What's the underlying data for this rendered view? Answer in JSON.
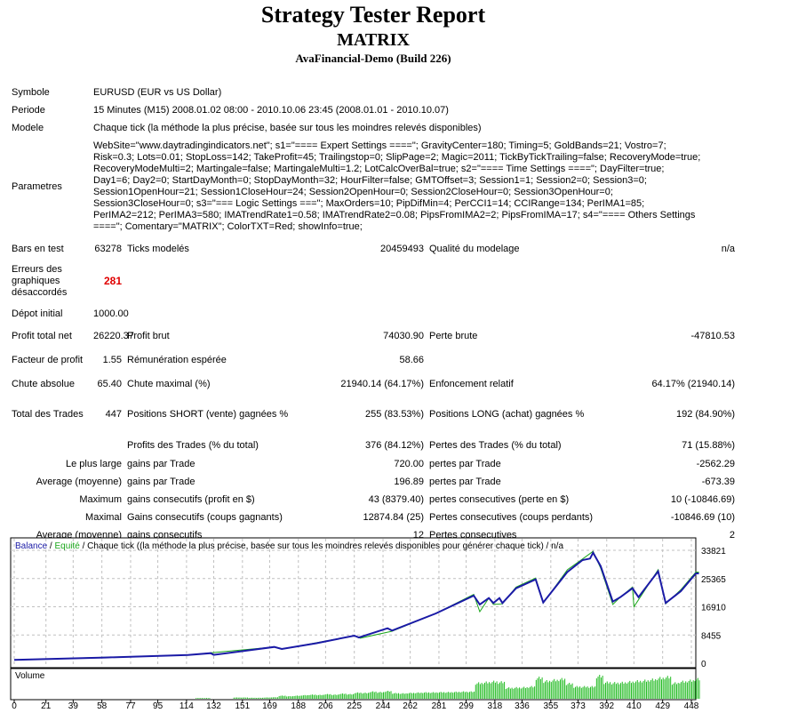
{
  "header": {
    "title": "Strategy Tester Report",
    "expert": "MATRIX",
    "server": "AvaFinancial-Demo (Build 226)"
  },
  "info": {
    "symbol_label": "Symbole",
    "symbol": "EURUSD (EUR vs US Dollar)",
    "period_label": "Periode",
    "period": "15 Minutes (M15) 2008.01.02 08:00 - 2010.10.06 23:45 (2008.01.01 - 2010.10.07)",
    "model_label": "Modele",
    "model": "Chaque tick (la méthode la plus précise, basée sur tous les moindres relevés disponibles)",
    "params_label": "Parametres",
    "params": "WebSite=\"www.daytradingindicators.net\"; s1=\"==== Expert Settings ====\"; GravityCenter=180; Timing=5; GoldBands=21; Vostro=7; Risk=0.3; Lots=0.01; StopLoss=142; TakeProfit=45; Trailingstop=0; SlipPage=2; Magic=2011; TickByTickTrailing=false; RecoveryMode=true; RecoveryModeMulti=2; Martingale=false; MartingaleMulti=1.2; LotCalcOverBal=true; s2=\"==== Time Settings ====\"; DayFilter=true; Day1=6; Day2=0; StartDayMonth=0; StopDayMonth=32; HourFilter=false; GMTOffset=3; Session1=1; Session2=0; Session3=0; Session1OpenHour=21; Session1CloseHour=24; Session2OpenHour=0; Session2CloseHour=0; Session3OpenHour=0; Session3CloseHour=0; s3=\"=== Logic Settings ===\"; MaxOrders=10; PipDifMin=4; PerCCI1=14; CCIRange=134; PerIMA1=85; PerIMA2=212; PerIMA3=580; IMATrendRate1=0.58; IMATrendRate2=0.08; PipsFromIMA2=2; PipsFromIMA=17; s4=\"==== Others Settings ====\"; Comentary=\"MATRIX\"; ColorTXT=Red; showInfo=true;"
  },
  "stats": {
    "bars_label": "Bars en test",
    "bars": "63278",
    "ticks_label": "Ticks modelés",
    "ticks": "20459493",
    "quality_label": "Qualité du modelage",
    "quality": "n/a",
    "errors_label": "Erreurs des graphiques désaccordés",
    "errors": "281",
    "deposit_label": "Dépot initial",
    "deposit": "1000.00",
    "net_label": "Profit total net",
    "net": "26220.37",
    "gross_profit_label": "Profit brut",
    "gross_profit": "74030.90",
    "gross_loss_label": "Perte brute",
    "gross_loss": "-47810.53",
    "pf_label": "Facteur de profit",
    "pf": "1.55",
    "payoff_label": "Rémunération espérée",
    "payoff": "58.66",
    "abs_dd_label": "Chute absolue",
    "abs_dd": "65.40",
    "max_dd_label": "Chute maximal (%)",
    "max_dd": "21940.14 (64.17%)",
    "rel_dd_label": "Enfoncement relatif",
    "rel_dd": "64.17% (21940.14)",
    "trades_label": "Total des Trades",
    "trades": "447",
    "short_label": "Positions SHORT (vente) gagnées %",
    "short": "255 (83.53%)",
    "long_label": "Positions LONG (achat) gagnées %",
    "long": "192 (84.90%)",
    "profit_trades_label": "Profits des Trades (% du total)",
    "profit_trades": "376 (84.12%)",
    "loss_trades_label": "Pertes des Trades (% du total)",
    "loss_trades": "71 (15.88%)",
    "largest_label": "Le plus large",
    "largest_win_label": "gains par Trade",
    "largest_win": "720.00",
    "largest_loss_label": "pertes par Trade",
    "largest_loss": "-2562.29",
    "avg_label": "Average (moyenne)",
    "avg_win_label": "gains par Trade",
    "avg_win": "196.89",
    "avg_loss_label": "pertes par Trade",
    "avg_loss": "-673.39",
    "maximum_label": "Maximum",
    "max_cons_win_label": "gains consecutifs (profit en $)",
    "max_cons_win": "43 (8379.40)",
    "max_cons_loss_label": "pertes consecutives (perte en $)",
    "max_cons_loss": "10 (-10846.69)",
    "maximal_label": "Maximal",
    "maximal_win_label": "Gains consecutifs (coups gagnants)",
    "maximal_win": "12874.84 (25)",
    "maximal_loss_label": "Pertes consecutives (coups perdants)",
    "maximal_loss": "-10846.69 (10)",
    "avg_cons_label": "Average (moyenne)",
    "avg_cons_win_label": "gains consecutifs",
    "avg_cons_win": "12",
    "avg_cons_loss_label": "Pertes consecutives",
    "avg_cons_loss": "2"
  },
  "chart_data": {
    "type": "line",
    "legend_balance": "Balance",
    "legend_sep1": " / ",
    "legend_equity": "Equité",
    "legend_rest": " / Chaque tick ((la méthode la plus précise, basée sur tous les moindres relevés disponibles pour générer chaque tick) / n/a",
    "volume_label": "Volume",
    "colors": {
      "balance": "#1a1aa6",
      "equity": "#1aa61a",
      "volume": "#22bb22",
      "grid": "#c0c0c0"
    },
    "xlim": [
      0,
      453
    ],
    "ylim": [
      0,
      33821
    ],
    "yticks": [
      "0",
      "8455",
      "16910",
      "25365",
      "33821"
    ],
    "xticks": [
      "0",
      "21",
      "39",
      "58",
      "77",
      "95",
      "114",
      "132",
      "151",
      "169",
      "188",
      "206",
      "225",
      "244",
      "262",
      "281",
      "299",
      "318",
      "336",
      "355",
      "373",
      "392",
      "410",
      "429",
      "448"
    ],
    "balance": [
      [
        0,
        1000
      ],
      [
        60,
        1700
      ],
      [
        115,
        2480
      ],
      [
        130,
        3000
      ],
      [
        132,
        2500
      ],
      [
        172,
        4880
      ],
      [
        177,
        4260
      ],
      [
        200,
        6000
      ],
      [
        225,
        8260
      ],
      [
        228,
        7700
      ],
      [
        247,
        10470
      ],
      [
        250,
        9770
      ],
      [
        279,
        14910
      ],
      [
        304,
        20240
      ],
      [
        308,
        17580
      ],
      [
        314,
        19530
      ],
      [
        317,
        18020
      ],
      [
        321,
        19530
      ],
      [
        323,
        18020
      ],
      [
        332,
        22450
      ],
      [
        345,
        25120
      ],
      [
        350,
        18190
      ],
      [
        366,
        27340
      ],
      [
        376,
        30890
      ],
      [
        381,
        31340
      ],
      [
        383,
        33110
      ],
      [
        388,
        29120
      ],
      [
        396,
        18460
      ],
      [
        401,
        19790
      ],
      [
        409,
        22450
      ],
      [
        413,
        19790
      ],
      [
        426,
        27520
      ],
      [
        431,
        18020
      ],
      [
        441,
        21570
      ],
      [
        451,
        26900
      ],
      [
        453,
        26900
      ]
    ],
    "equity": [
      [
        0,
        1000
      ],
      [
        115,
        2480
      ],
      [
        172,
        4880
      ],
      [
        177,
        4200
      ],
      [
        225,
        8260
      ],
      [
        229,
        7500
      ],
      [
        250,
        9600
      ],
      [
        279,
        14910
      ],
      [
        304,
        20600
      ],
      [
        308,
        15450
      ],
      [
        314,
        19530
      ],
      [
        317,
        17600
      ],
      [
        323,
        17800
      ],
      [
        332,
        22800
      ],
      [
        345,
        25500
      ],
      [
        350,
        18000
      ],
      [
        366,
        28000
      ],
      [
        376,
        31200
      ],
      [
        383,
        33500
      ],
      [
        388,
        28500
      ],
      [
        396,
        17600
      ],
      [
        401,
        19790
      ],
      [
        409,
        22800
      ],
      [
        410,
        16910
      ],
      [
        413,
        19000
      ],
      [
        426,
        28000
      ],
      [
        431,
        17800
      ],
      [
        441,
        22000
      ],
      [
        451,
        27300
      ],
      [
        453,
        27300
      ]
    ],
    "volume_step": 5,
    "volume": [
      0,
      0,
      0,
      0,
      0,
      0,
      0,
      0,
      0,
      0,
      0,
      0,
      0,
      0,
      0,
      0,
      0,
      0,
      0,
      0,
      0,
      0,
      0,
      0,
      0.3,
      0.3,
      0,
      0,
      0,
      0.5,
      0.5,
      0.4,
      0.4,
      0.5,
      0.6,
      1.2,
      1.0,
      1.2,
      1.4,
      1.6,
      1.5,
      1.8,
      1.6,
      2.0,
      1.8,
      2.4,
      2.3,
      2.8,
      2.6,
      3.0,
      2.2,
      2.1,
      2.3,
      2.4,
      2.5,
      2.5,
      2.6,
      2.6,
      2.7,
      2.8,
      2.8,
      6.2,
      6.5,
      6.8,
      6.6,
      4.3,
      4.4,
      4.5,
      4.8,
      8.3,
      7.0,
      7.4,
      7.8,
      6.0,
      4.8,
      4.8,
      4.8,
      9.0,
      6.5,
      6.3,
      6.4,
      6.7,
      7.0,
      7.2,
      7.6,
      8.2,
      8.6,
      6.2,
      6.8,
      7.2,
      7.8
    ]
  }
}
